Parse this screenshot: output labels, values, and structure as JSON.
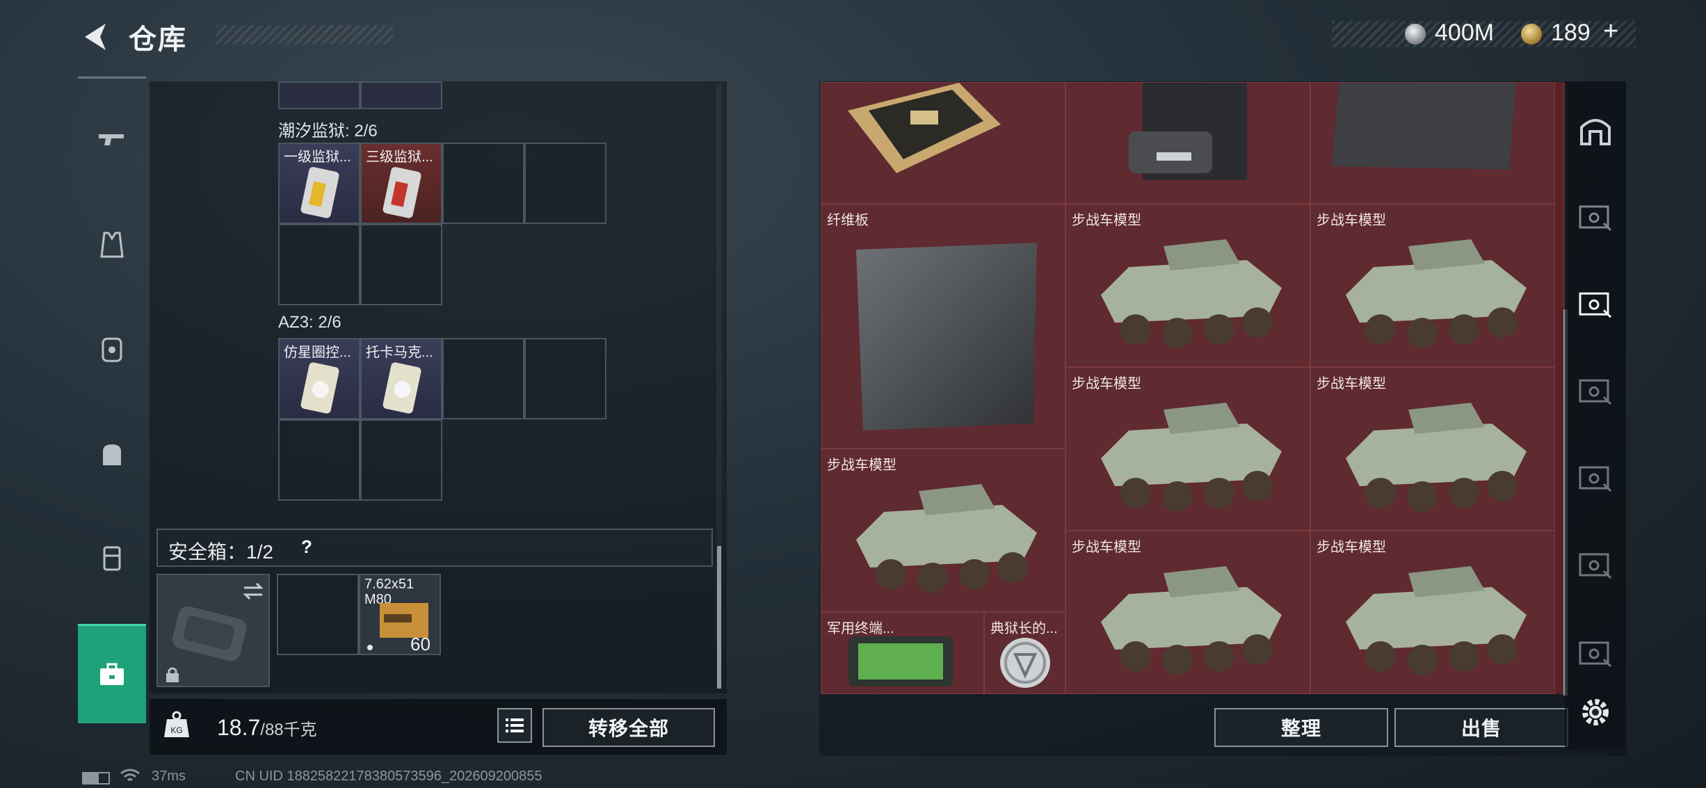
{
  "header": {
    "title": "仓库"
  },
  "currency": {
    "silver": "400M",
    "gold": "189",
    "add": "+"
  },
  "left_nav": {
    "items": [
      "weapons",
      "vest",
      "backpack-rig",
      "backpack",
      "pouch",
      "secure-box"
    ]
  },
  "containers": {
    "tide_prison": {
      "label": "潮汐监狱: 2/6",
      "items": [
        {
          "label": "一级监狱...",
          "rarity": "blue"
        },
        {
          "label": "三级监狱...",
          "rarity": "red"
        }
      ]
    },
    "az3": {
      "label": "AZ3: 2/6",
      "items": [
        {
          "label": "仿星圈控...",
          "rarity": "blue"
        },
        {
          "label": "托卡马克...",
          "rarity": "blue"
        }
      ]
    }
  },
  "safe_box": {
    "label": "安全箱：1/2",
    "help": "?",
    "ammo": {
      "name": "7.62x51 M80",
      "count": "60"
    }
  },
  "bottom": {
    "weight": "18.7",
    "weight_max": "/88千克",
    "transfer_all": "转移全部"
  },
  "stash": {
    "items": {
      "fiberboard": "纤维板",
      "ifv1": "步战车模型",
      "ifv2": "步战车模型",
      "ifv3": "步战车模型",
      "ifv4": "步战车模型",
      "ifv5": "步战车模型",
      "ifv6": "步战车模型",
      "ifv7": "步战车模型",
      "terminal": "军用终端...",
      "warden": "典狱长的..."
    },
    "sort": "整理",
    "sell": "出售"
  },
  "status": {
    "ping": "37ms",
    "uid": "CN UID 18825822178380573596_202609200855"
  },
  "colors": {
    "accent": "#1fa27a",
    "stash_bg": "#5a2127"
  }
}
